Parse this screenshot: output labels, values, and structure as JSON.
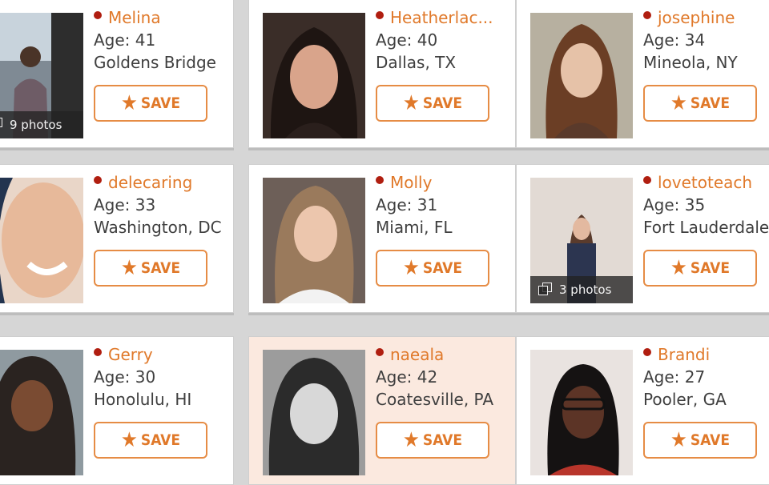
{
  "colors": {
    "accent": "#e0792a",
    "online_dot": "#b01e10",
    "highlight_card": "#fbe9df",
    "text": "#3f3f3f"
  },
  "profiles": [
    {
      "name": "Melina",
      "age": "Age: 41",
      "location": "Goldens Bridge",
      "save_label": "SAVE",
      "photo_count": "9 photos",
      "online": true,
      "highlighted": false,
      "icons": [
        "online-dot-icon",
        "star-icon",
        "photos-stack-icon"
      ]
    },
    {
      "name": "Heatherlac...",
      "age": "Age: 40",
      "location": "Dallas, TX",
      "save_label": "SAVE",
      "photo_count": null,
      "online": true,
      "highlighted": false
    },
    {
      "name": "josephine",
      "age": "Age: 34",
      "location": "Mineola, NY",
      "save_label": "SAVE",
      "photo_count": null,
      "online": true,
      "highlighted": false
    },
    {
      "name": "delecaring",
      "age": "Age: 33",
      "location": "Washington, DC",
      "save_label": "SAVE",
      "photo_count": null,
      "online": true,
      "highlighted": false
    },
    {
      "name": "Molly",
      "age": "Age: 31",
      "location": "Miami, FL",
      "save_label": "SAVE",
      "photo_count": null,
      "online": true,
      "highlighted": false
    },
    {
      "name": "lovetoteach",
      "age": "Age: 35",
      "location": "Fort Lauderdale",
      "save_label": "SAVE",
      "photo_count": "3 photos",
      "online": true,
      "highlighted": false
    },
    {
      "name": "Gerry",
      "age": "Age: 30",
      "location": "Honolulu, HI",
      "save_label": "SAVE",
      "photo_count": null,
      "online": true,
      "highlighted": false
    },
    {
      "name": "naeala",
      "age": "Age: 42",
      "location": "Coatesville, PA",
      "save_label": "SAVE",
      "photo_count": null,
      "online": true,
      "highlighted": true
    },
    {
      "name": "Brandi",
      "age": "Age: 27",
      "location": "Pooler, GA",
      "save_label": "SAVE",
      "photo_count": null,
      "online": true,
      "highlighted": false
    }
  ]
}
